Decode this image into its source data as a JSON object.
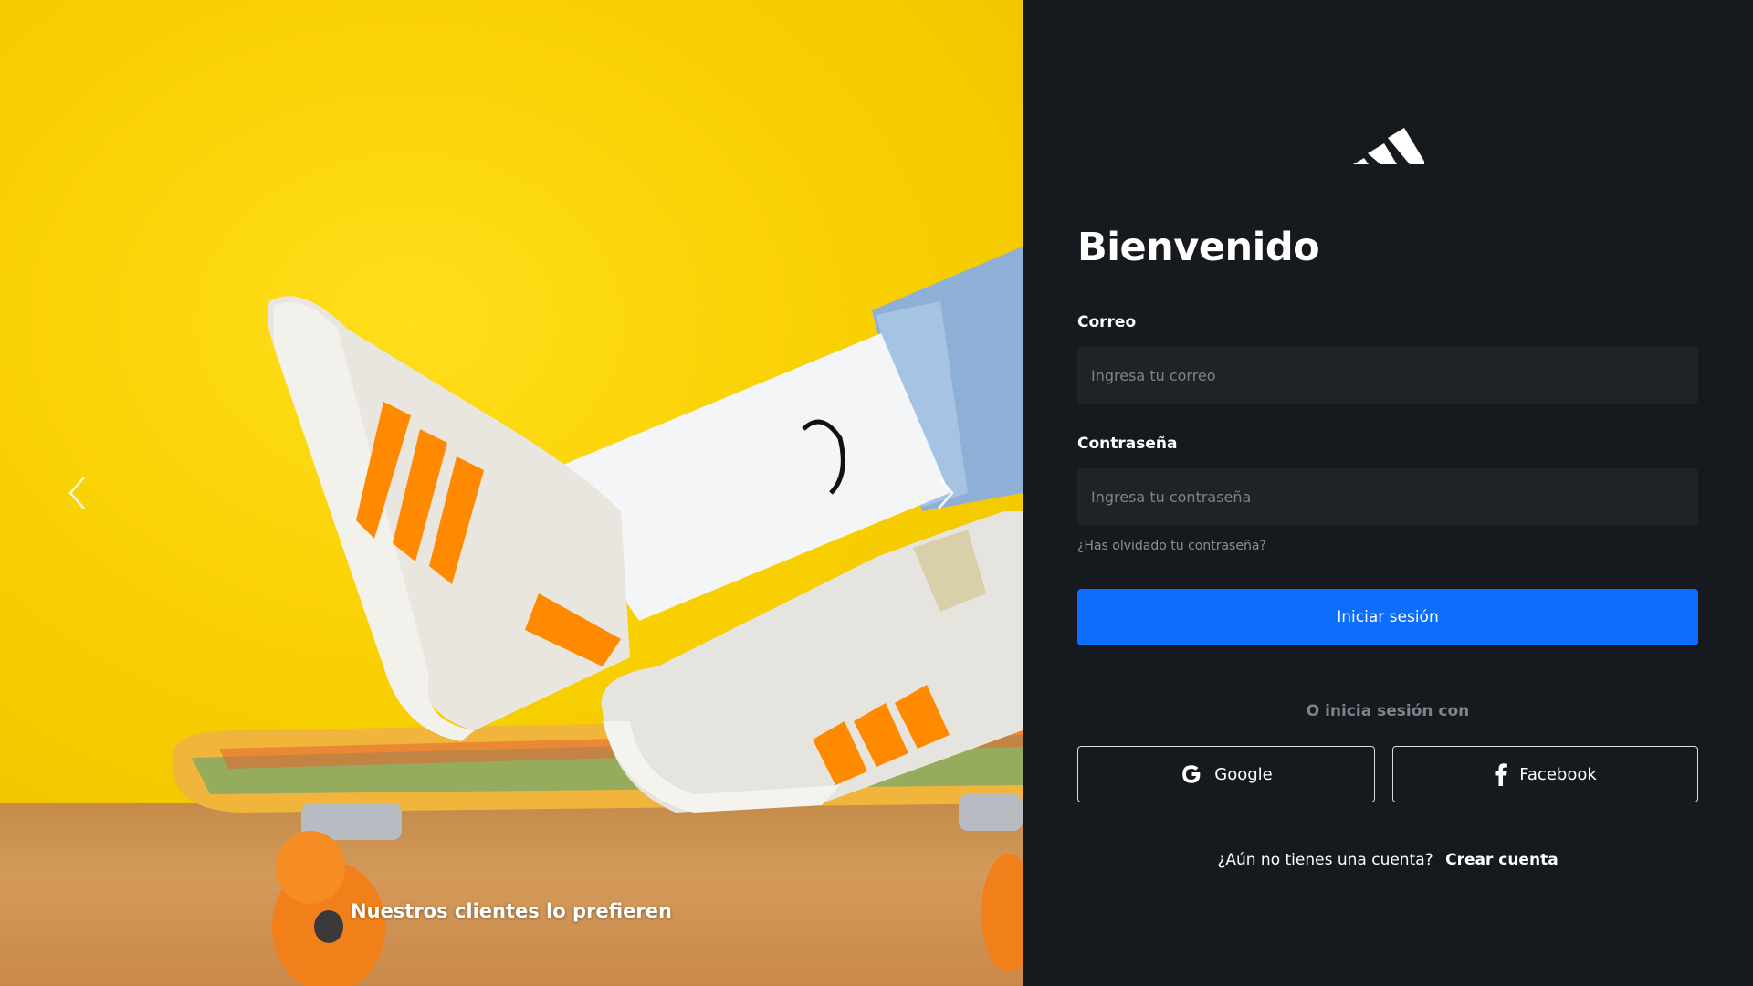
{
  "hero": {
    "caption": "Nuestros clientes lo prefieren",
    "prev_icon": "chevron-left-icon",
    "next_icon": "chevron-right-icon",
    "colors": {
      "wall": "#f8cf00",
      "floor": "#c58b4b",
      "stripe": "#ff8a00"
    }
  },
  "panel": {
    "logo_icon": "adidas-logo",
    "title": "Bienvenido",
    "email": {
      "label": "Correo",
      "placeholder": "Ingresa tu correo",
      "value": ""
    },
    "password": {
      "label": "Contraseña",
      "placeholder": "Ingresa tu contraseña",
      "value": ""
    },
    "forgot_link": "¿Has olvidado tu contraseña?",
    "login_button": "Iniciar sesión",
    "or_text": "O inicia sesión con",
    "google_button": "Google",
    "google_icon": "google-icon",
    "facebook_button": "Facebook",
    "facebook_icon": "facebook-icon",
    "signup_prompt": "¿Aún no tienes una cuenta?",
    "signup_link": "Crear cuenta"
  },
  "colors": {
    "panel_bg": "#161a1e",
    "field_bg": "#1f2328",
    "primary": "#0d6efd",
    "muted_text": "#7d838a"
  }
}
